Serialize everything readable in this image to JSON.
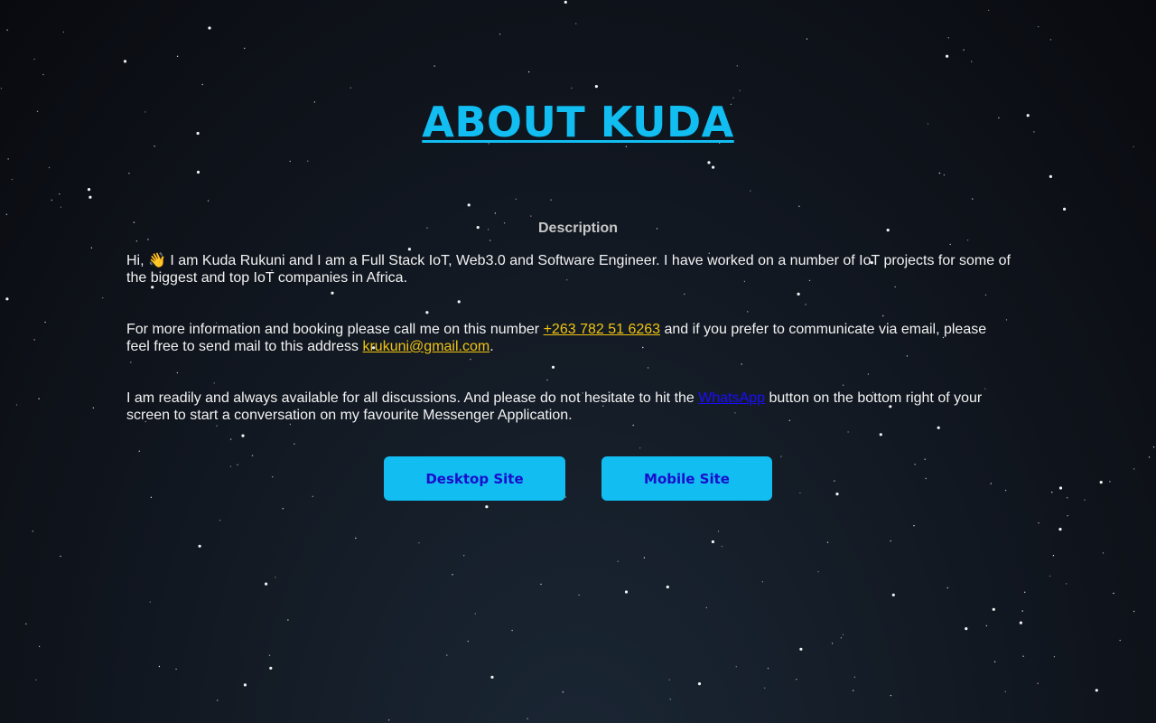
{
  "page": {
    "title": "ABOUT KUDA",
    "description_heading": "Description"
  },
  "paragraphs": {
    "intro_pre": "Hi, ",
    "wave_emoji": "👋",
    "intro_post": " I am Kuda Rukuni and I am a Full Stack IoT, Web3.0 and Software Engineer. I have worked on a number of IoT projects for some of the biggest and top IoT companies in Africa.",
    "contact_pre": "For more information and booking please call me on this number ",
    "phone": "+263 782 51 6263",
    "contact_mid": " and if you prefer to communicate via email, please feel free to send mail to this address ",
    "email": "krukuni@gmail.com",
    "contact_post": ".",
    "avail_pre": "I am readily and always available for all discussions. And please do not hesitate to hit the ",
    "whatsapp": "WhatsApp",
    "avail_post": " button on the bottom right of your screen to start a conversation on my favourite Messenger Application."
  },
  "buttons": {
    "desktop": "Desktop Site",
    "mobile": "Mobile Site"
  },
  "colors": {
    "title": "#11bdf1",
    "link_gold": "#f1c40f",
    "link_blue": "#1a0dff",
    "button_bg": "#12bdf2",
    "button_text": "#1a0dcc"
  }
}
